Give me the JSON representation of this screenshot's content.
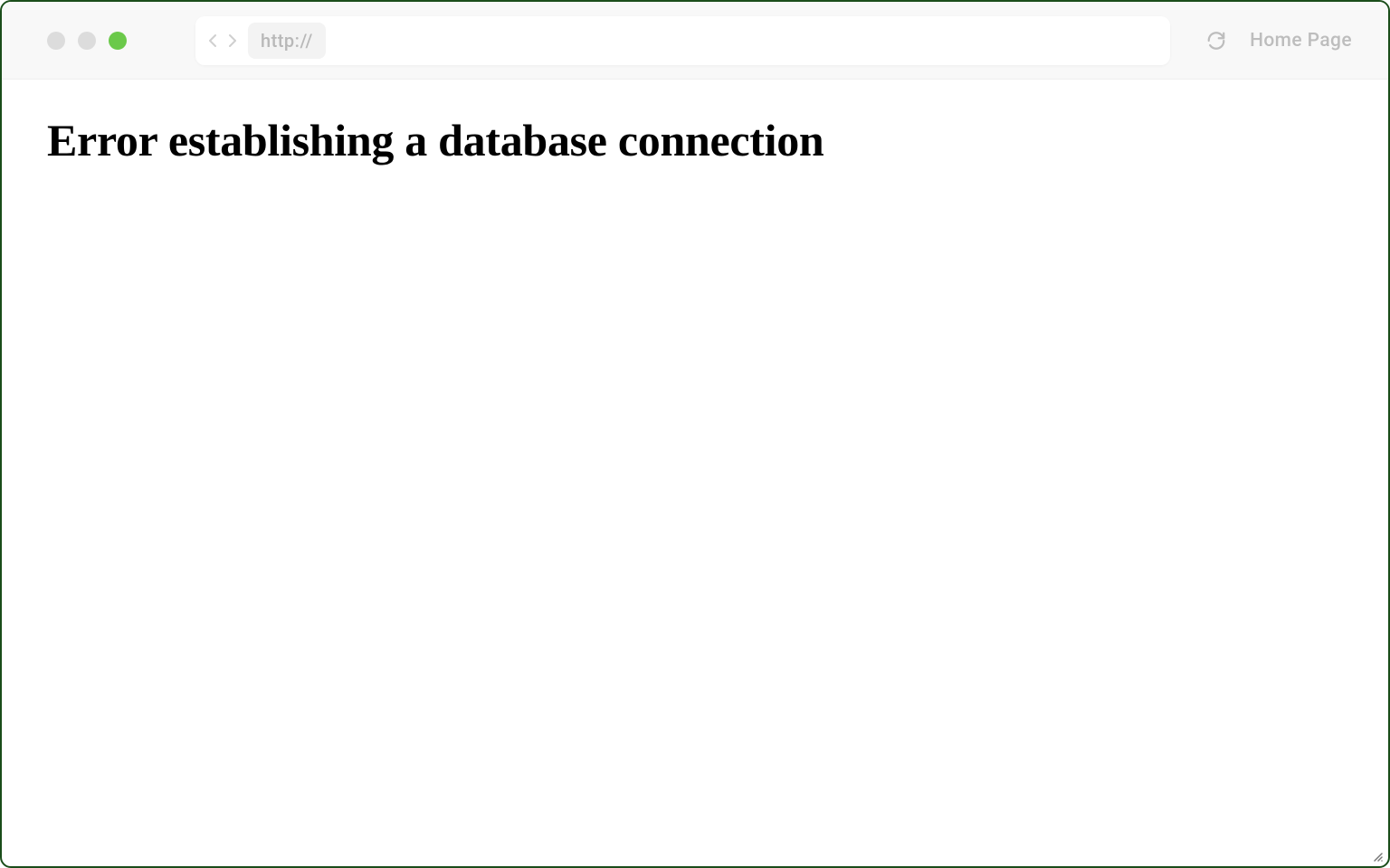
{
  "toolbar": {
    "url_prefix": "http://",
    "home_label": "Home Page"
  },
  "content": {
    "error_heading": "Error establishing a database connection"
  }
}
